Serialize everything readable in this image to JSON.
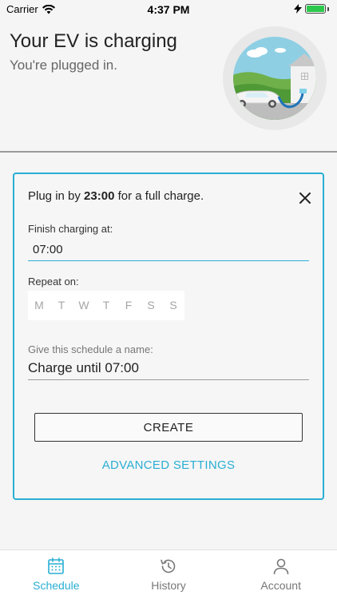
{
  "status_bar": {
    "carrier": "Carrier",
    "time": "4:37 PM"
  },
  "header": {
    "title": "Your EV is charging",
    "subtitle": "You're plugged in."
  },
  "card": {
    "intro_prefix": "Plug in by ",
    "intro_time": "23:00",
    "intro_suffix": " for a full charge.",
    "finish_label": "Finish charging at:",
    "finish_value": "07:00",
    "repeat_label": "Repeat on:",
    "days": [
      "M",
      "T",
      "W",
      "T",
      "F",
      "S",
      "S"
    ],
    "name_label": "Give this schedule a name:",
    "name_value": "Charge until 07:00",
    "create_label": "CREATE",
    "advanced_label": "ADVANCED SETTINGS"
  },
  "tabs": [
    {
      "label": "Schedule",
      "icon": "calendar-icon",
      "active": true
    },
    {
      "label": "History",
      "icon": "history-icon",
      "active": false
    },
    {
      "label": "Account",
      "icon": "account-icon",
      "active": false
    }
  ],
  "colors": {
    "accent": "#2aaed3",
    "background": "#f5f5f5",
    "battery": "#2cc84d"
  }
}
